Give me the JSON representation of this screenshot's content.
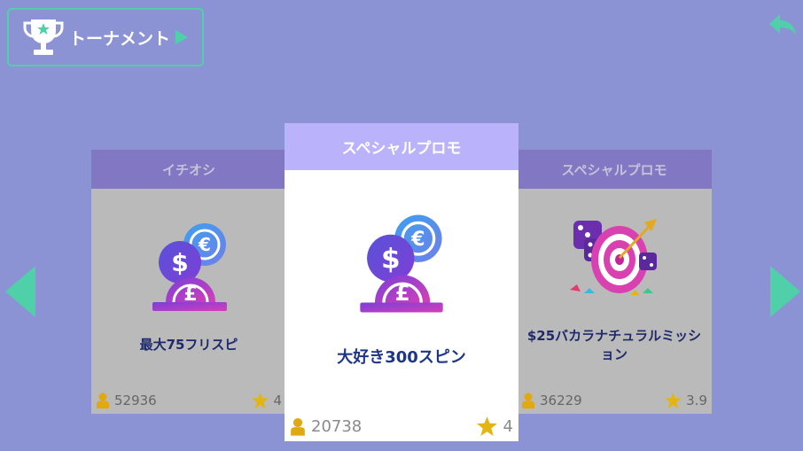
{
  "header": {
    "tournament_label": "トーナメント"
  },
  "carousel": {
    "cards": [
      {
        "header": "イチオシ",
        "title": "最大75フリスピ",
        "players": "52936",
        "rating": "4",
        "icon": "currency-coins-icon"
      },
      {
        "header": "スペシャルプロモ",
        "title": "大好き300スピン",
        "players": "20738",
        "rating": "4",
        "icon": "currency-coins-icon"
      },
      {
        "header": "スペシャルプロモ",
        "title": "$25バカラナチュラルミッション",
        "players": "36229",
        "rating": "3.9",
        "icon": "dice-target-icon"
      }
    ]
  },
  "colors": {
    "background": "#8b93d4",
    "accent": "#4fd0a8",
    "card_header": "#8177c2",
    "selected_header": "#bab2fb",
    "title": "#1e2a6b",
    "star": "#e2b512"
  }
}
